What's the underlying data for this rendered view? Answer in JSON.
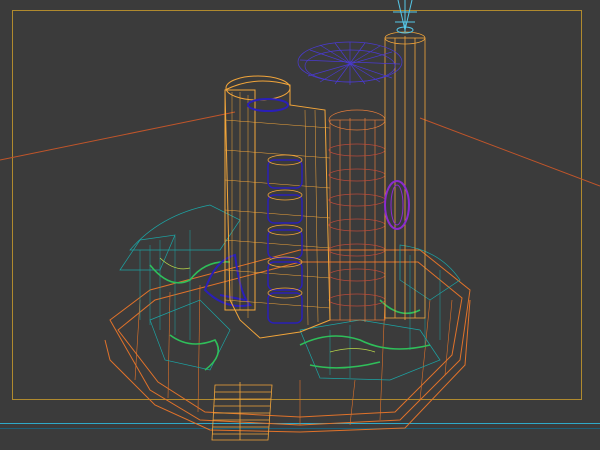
{
  "viewport": {
    "view": "perspective",
    "render_mode": "wireframe",
    "colors": {
      "background": "#3b3b3b",
      "frame": "#b08a2e",
      "guide_line": "#c0552a",
      "building_main": "#f2a53a",
      "building_secondary": "#e07a3a",
      "glass": "#2a1fb8",
      "landscape_green": "#2fbf5a",
      "landscape_teal": "#1ca4a4",
      "podium_orange": "#e0722a",
      "antenna": "#55c8e8"
    },
    "objects": [
      "main-tower",
      "cylinder-tower",
      "tall-column",
      "podium-ring",
      "landscape",
      "antenna",
      "stair"
    ]
  }
}
